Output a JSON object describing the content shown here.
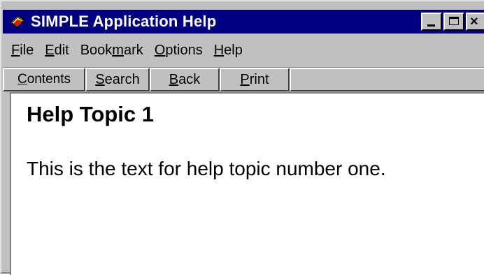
{
  "window": {
    "title": "SIMPLE Application Help",
    "icon": "help-book-icon",
    "controls": {
      "minimize_icon": "minimize-icon",
      "maximize_icon": "maximize-icon",
      "close_glyph": "×"
    }
  },
  "menubar": {
    "items": [
      {
        "pre": "",
        "key": "F",
        "post": "ile"
      },
      {
        "pre": "",
        "key": "E",
        "post": "dit"
      },
      {
        "pre": "Book",
        "key": "m",
        "post": "ark"
      },
      {
        "pre": "",
        "key": "O",
        "post": "ptions"
      },
      {
        "pre": "",
        "key": "H",
        "post": "elp"
      }
    ]
  },
  "buttonbar": {
    "contents": {
      "pre": "",
      "key": "C",
      "post": "ontents"
    },
    "search": {
      "pre": "",
      "key": "S",
      "post": "earch"
    },
    "back": {
      "pre": "",
      "key": "B",
      "post": "ack"
    },
    "print": {
      "pre": "",
      "key": "P",
      "post": "rint"
    }
  },
  "topic": {
    "heading": "Help Topic 1",
    "body": "This is the text for help topic number one."
  },
  "colors": {
    "titlebar_bg": "#000080",
    "chrome": "#c0c0c0",
    "content_bg": "#ffffff"
  }
}
